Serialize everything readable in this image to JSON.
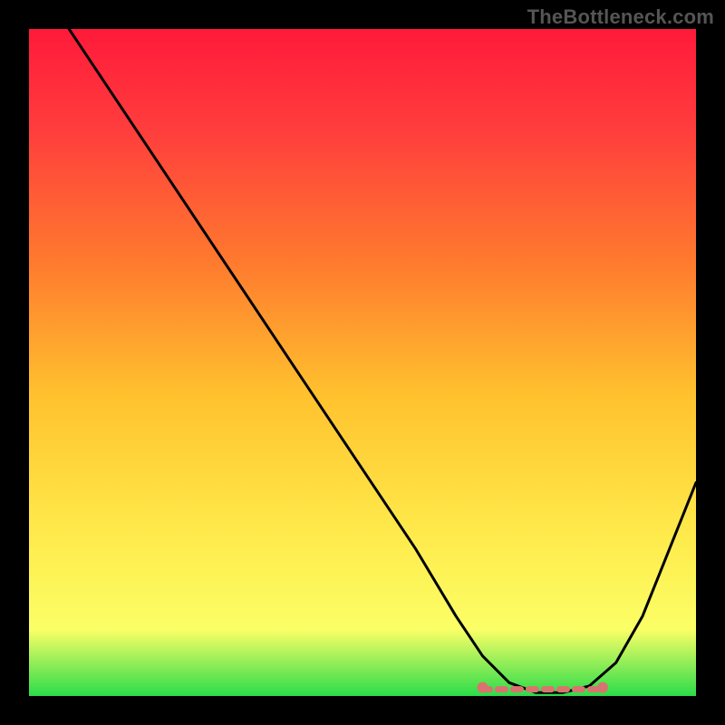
{
  "watermark": "TheBottleneck.com",
  "chart_data": {
    "type": "line",
    "title": "",
    "xlabel": "",
    "ylabel": "",
    "xlim": [
      0,
      100
    ],
    "ylim": [
      0,
      100
    ],
    "curve": [
      {
        "x": 6,
        "y": 100
      },
      {
        "x": 10,
        "y": 94
      },
      {
        "x": 20,
        "y": 79
      },
      {
        "x": 30,
        "y": 64
      },
      {
        "x": 40,
        "y": 49
      },
      {
        "x": 50,
        "y": 34
      },
      {
        "x": 58,
        "y": 22
      },
      {
        "x": 64,
        "y": 12
      },
      {
        "x": 68,
        "y": 6
      },
      {
        "x": 72,
        "y": 2
      },
      {
        "x": 76,
        "y": 0.5
      },
      {
        "x": 80,
        "y": 0.5
      },
      {
        "x": 84,
        "y": 1.5
      },
      {
        "x": 88,
        "y": 5
      },
      {
        "x": 92,
        "y": 12
      },
      {
        "x": 96,
        "y": 22
      },
      {
        "x": 100,
        "y": 32
      }
    ],
    "optimal_band": {
      "x_start": 68,
      "x_end": 86,
      "y": 1
    },
    "gradient_stops": [
      {
        "offset": 0,
        "color": "#ff1a3a"
      },
      {
        "offset": 0.15,
        "color": "#ff3d3d"
      },
      {
        "offset": 0.35,
        "color": "#ff7a2e"
      },
      {
        "offset": 0.55,
        "color": "#ffc22e"
      },
      {
        "offset": 0.75,
        "color": "#ffe94a"
      },
      {
        "offset": 0.9,
        "color": "#fbff66"
      },
      {
        "offset": 1.0,
        "color": "#2bdc4a"
      }
    ],
    "marker_color": "#d9736f",
    "curve_color": "#000000"
  }
}
